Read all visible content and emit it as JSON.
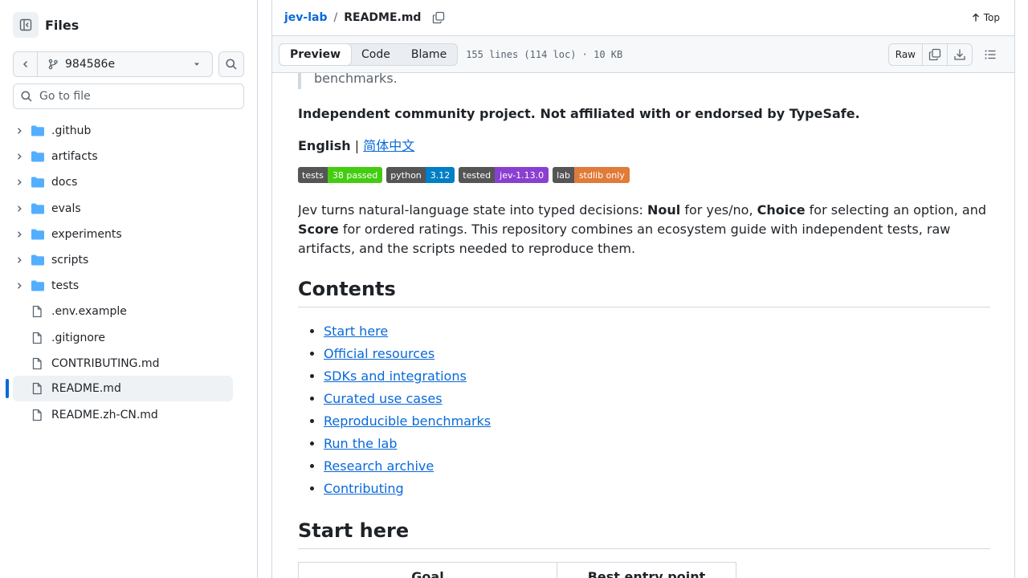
{
  "sidebar": {
    "title": "Files",
    "branch": "984586e",
    "goto_placeholder": "Go to file",
    "items": [
      {
        "type": "folder",
        "label": ".github"
      },
      {
        "type": "folder",
        "label": "artifacts"
      },
      {
        "type": "folder",
        "label": "docs"
      },
      {
        "type": "folder",
        "label": "evals"
      },
      {
        "type": "folder",
        "label": "experiments"
      },
      {
        "type": "folder",
        "label": "scripts"
      },
      {
        "type": "folder",
        "label": "tests"
      },
      {
        "type": "file",
        "label": ".env.example"
      },
      {
        "type": "file",
        "label": ".gitignore"
      },
      {
        "type": "file",
        "label": "CONTRIBUTING.md"
      },
      {
        "type": "file",
        "label": "README.md",
        "selected": true
      },
      {
        "type": "file",
        "label": "README.zh-CN.md"
      }
    ]
  },
  "header": {
    "repo": "jev-lab",
    "separator": "/",
    "file": "README.md",
    "top_label": "Top"
  },
  "filebar": {
    "tabs": [
      "Preview",
      "Code",
      "Blame"
    ],
    "active_tab": "Preview",
    "meta": "155 lines (114 loc) · 10 KB",
    "raw_label": "Raw"
  },
  "readme": {
    "quote_tail": "benchmarks.",
    "disclaimer": "Independent community project. Not affiliated with or endorsed by TypeSafe.",
    "lang_current": "English",
    "lang_sep": "|",
    "lang_other": "简体中文",
    "badges": [
      {
        "label": "tests",
        "value": "38 passed",
        "color": "#4c1"
      },
      {
        "label": "python",
        "value": "3.12",
        "color": "#007ec6"
      },
      {
        "label": "tested",
        "value": "jev-1.13.0",
        "color": "#8a3fd1"
      },
      {
        "label": "lab",
        "value": "stdlib only",
        "color": "#e07b39"
      }
    ],
    "intro": {
      "t1": "Jev turns natural-language state into typed decisions: ",
      "b1": "Noul",
      "t2": " for yes/no, ",
      "b2": "Choice",
      "t3": " for selecting an option, and ",
      "b3": "Score",
      "t4": " for ordered ratings. This repository combines an ecosystem guide with independent tests, raw artifacts, and the scripts needed to reproduce them."
    },
    "contents_heading": "Contents",
    "contents": [
      "Start here",
      "Official resources",
      "SDKs and integrations",
      "Curated use cases",
      "Reproducible benchmarks",
      "Run the lab",
      "Research archive",
      "Contributing"
    ],
    "start_heading": "Start here",
    "table_headers": [
      "Goal",
      "Best entry point"
    ]
  },
  "colors": {
    "accent": "#0969da",
    "folder": "#54aeff",
    "border": "#d1d9e0"
  }
}
